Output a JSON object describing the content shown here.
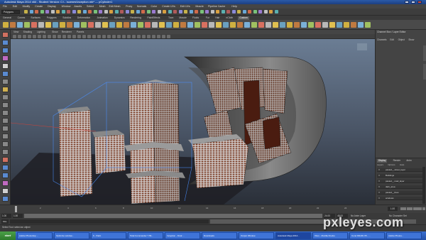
{
  "window": {
    "title": "Autodesk Maya 2014 x64 - Student Version: C:\\...\\scenes\\Inception.mb* --- pCylinder1"
  },
  "menubar": {
    "items": [
      "File",
      "Edit",
      "Modify",
      "Create",
      "Display",
      "Window",
      "Assets",
      "Select",
      "Mesh",
      "Edit Mesh",
      "Proxy",
      "Normals",
      "Color",
      "Create UVs",
      "Edit UVs",
      "Muscle",
      "Pipeline Cache",
      "Help"
    ]
  },
  "status_line": {
    "mode": "Polygons"
  },
  "shelf_tabs": {
    "items": [
      "General",
      "Curves",
      "Surfaces",
      "Polygons",
      "Subdivs",
      "Deformation",
      "Animation",
      "Dynamics",
      "Rendering",
      "PaintEffects",
      "Toon",
      "Muscle",
      "Fluids",
      "Fur",
      "Hair",
      "nCloth",
      "Custom"
    ],
    "active": "Custom"
  },
  "viewport": {
    "menu": [
      "View",
      "Shading",
      "Lighting",
      "Show",
      "Renderer",
      "Panels"
    ]
  },
  "channel_box": {
    "title": "Channel Box / Layer Editor",
    "menu": [
      "Channels",
      "Edit",
      "Object",
      "Show"
    ]
  },
  "layer_editor": {
    "tabs": [
      "Display",
      "Render",
      "Anim"
    ],
    "active_tab": "Display",
    "options": [
      "Layers",
      "Options",
      "Help"
    ],
    "layers": [
      {
        "v": "V",
        "name": "pasted__street_layer"
      },
      {
        "v": "V",
        "name": "Buildings"
      },
      {
        "v": "V",
        "name": "pasted__road_layer"
      },
      {
        "v": "V",
        "name": "dark_area"
      },
      {
        "v": "V",
        "name": "pasted__lines"
      },
      {
        "v": "V",
        "name": "windows"
      }
    ]
  },
  "time_slider": {
    "ticks": [
      "2",
      "4",
      "6",
      "8",
      "10",
      "12",
      "14",
      "16",
      "18",
      "20",
      "22",
      "24"
    ],
    "current_frame": "1.00"
  },
  "range_slider": {
    "start": "1.00",
    "inner_start": "1.00",
    "inner_end": "24.00",
    "end": "48.00",
    "anim_layer": "No Anim Layer",
    "char_set": "No Character Set"
  },
  "command_line": {
    "lang": "MEL"
  },
  "help_line": {
    "text": "Select Tool: select an object"
  },
  "taskbar": {
    "start": "start",
    "tasks": [
      {
        "label": "Adobe Photoshop ...",
        "active": false
      },
      {
        "label": "Optimize window...",
        "active": false
      },
      {
        "label": "6 - Paint",
        "active": false
      },
      {
        "label": "Total Commander 7.56...",
        "active": false
      },
      {
        "label": "Inception - Final ...",
        "active": false
      },
      {
        "label": "Downloads",
        "active": false
      },
      {
        "label": "Output Window",
        "active": false
      },
      {
        "label": "Autodesk Maya 2014...",
        "active": true
      },
      {
        "label": "Xbox - Mozilla Firefox",
        "active": false
      },
      {
        "label": "Corel DRAW X5 - ...",
        "active": false
      },
      {
        "label": "Adobe Photos...",
        "active": false
      }
    ]
  },
  "watermark": {
    "text": "pxleyes.com"
  },
  "colors": {
    "title_bar": "#2a5aa8",
    "viewport_top": "#6b7d94",
    "viewport_bottom": "#2a2f38",
    "building_window": "#7a3a22",
    "selection_wire": "#4a90ff"
  }
}
